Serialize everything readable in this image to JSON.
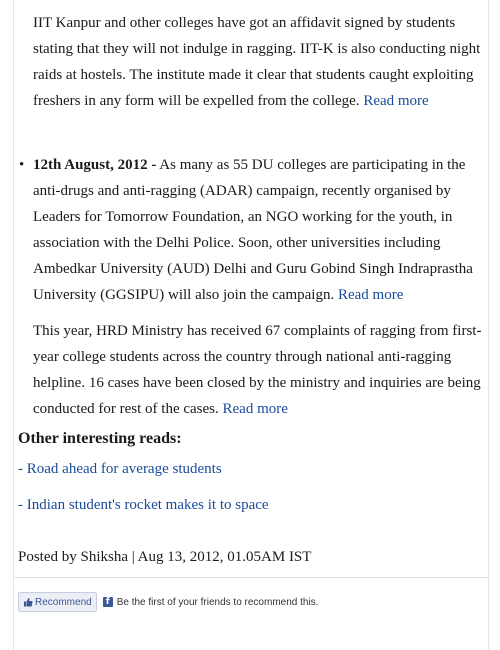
{
  "article": {
    "para1": {
      "text": "IIT Kanpur and other colleges have got an affidavit signed by students stating that they will not indulge in ragging. IIT-K is also conducting night raids at hostels. The institute made it clear that students caught exploiting freshers in any form will be expelled from the college.",
      "link": "Read more"
    },
    "bullet": {
      "symbol": "•",
      "date": "12th August, 2012 -",
      "text": "As many as 55 DU colleges are participating in the anti-drugs and anti-ragging (ADAR) campaign, recently organised by Leaders for Tomorrow Foundation, an NGO working for the youth, in association with the Delhi Police. Soon, other universities including Ambedkar University (AUD) Delhi and Guru Gobind Singh Indraprastha University (GGSIPU) will also join the campaign.",
      "link": "Read more"
    },
    "para3": {
      "text": "This year, HRD Ministry has received 67 complaints of ragging from first-year college students across the country through national anti-ragging helpline. 16 cases have been closed by the ministry and inquiries are being conducted for rest of the cases.",
      "link": "Read more"
    }
  },
  "other_reads": {
    "heading": "Other interesting reads:",
    "dash": "-",
    "links": [
      "Road ahead for average students",
      "Indian student's rocket makes it to space"
    ]
  },
  "posted": "Posted by Shiksha | Aug 13, 2012, 01.05AM IST",
  "facebook": {
    "button_label": "Recommend",
    "icon_letter": "f",
    "text": "Be the first of your friends to recommend this.",
    "brand_color": "#3b5998"
  },
  "colors": {
    "link": "#1a4b9b",
    "text": "#1a1a1a"
  }
}
